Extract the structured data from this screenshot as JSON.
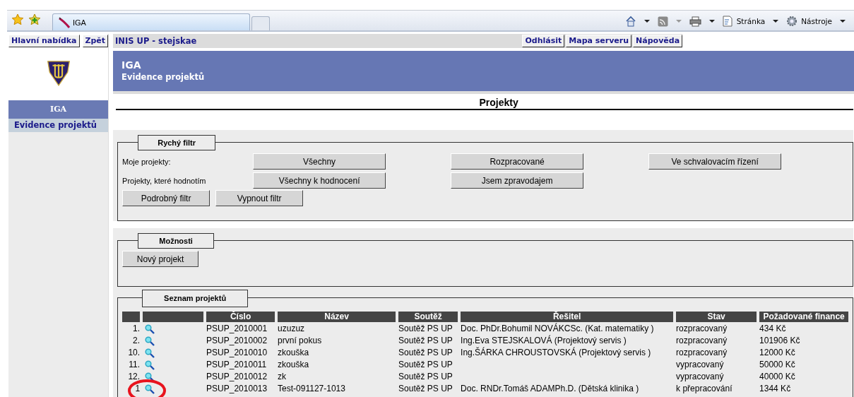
{
  "browser": {
    "tab_title": "IGA",
    "menus": [
      "Stránka",
      "Nástroje"
    ]
  },
  "nav": {
    "left_buttons": [
      "Hlavní nabídka",
      "Zpět"
    ],
    "user": "INIS UP - stejskae",
    "right_buttons": [
      "Odhlásit",
      "Mapa serveru",
      "Nápověda"
    ]
  },
  "sidebar": {
    "title": "IGA",
    "items": [
      "Evidence projektů"
    ]
  },
  "header": {
    "title": "IGA",
    "subtitle": "Evidence projektů"
  },
  "page_title": "Projekty",
  "quick_filter": {
    "legend": "Rychý filtr",
    "rows": [
      {
        "label": "Moje projekty:",
        "buttons": [
          "Všechny",
          "Rozpracované",
          "Ve schvalovacím řízení"
        ]
      },
      {
        "label": "Projekty, které hodnotím",
        "buttons": [
          "Všechny k hodnocení",
          "Jsem zpravodajem"
        ]
      }
    ],
    "buttons": [
      "Podrobný filtr",
      "Vypnout filtr"
    ]
  },
  "options": {
    "legend": "Možnosti",
    "buttons": [
      "Nový projekt"
    ]
  },
  "project_list": {
    "legend": "Seznam projektů",
    "columns": [
      "Číslo",
      "Název",
      "Soutěž",
      "Řešitel",
      "Stav",
      "Požadované finance"
    ],
    "rows": [
      {
        "number": "1.",
        "cells": [
          "PSUP_2010001",
          "uzuzuz",
          "Soutěž PS UP",
          "Doc. PhDr.Bohumil NOVÁKCSc. (Kat. matematiky )",
          "rozpracovaný",
          "434 Kč"
        ]
      },
      {
        "number": "2.",
        "cells": [
          "PSUP_2010002",
          "první pokus",
          "Soutěž PS UP",
          "Ing.Eva STEJSKALOVÁ (Projektový servis )",
          "rozpracovaný",
          "101906 Kč"
        ]
      },
      {
        "number": "10.",
        "cells": [
          "PSUP_2010010",
          "zkouška",
          "Soutěž PS UP",
          "Ing.ŠÁRKA CHROUSTOVSKÁ (Projektový servis )",
          "rozpracovaný",
          "12000 Kč"
        ]
      },
      {
        "number": "11.",
        "cells": [
          "PSUP_2010011",
          "zkouška",
          "Soutěž PS UP",
          "",
          "vypracovaný",
          "50000 Kč"
        ]
      },
      {
        "number": "12.",
        "cells": [
          "PSUP_2010012",
          "zk",
          "Soutěž PS UP",
          "",
          "vypracovaný",
          "40000 Kč"
        ]
      },
      {
        "number": "1",
        "cells": [
          "PSUP_2010013",
          "Test-091127-1013",
          "Soutěž PS UP",
          "Doc. RNDr.Tomáš ADAMPh.D. (Dětská klinika )",
          "k přepracování",
          "1344 Kč"
        ],
        "highlighted": true
      }
    ]
  }
}
